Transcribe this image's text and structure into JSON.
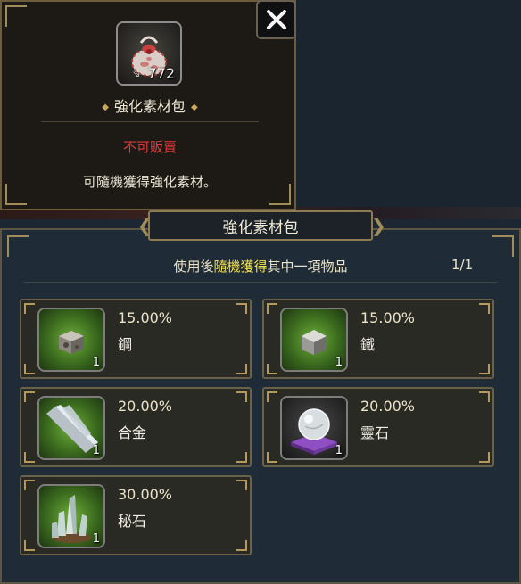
{
  "tooltip": {
    "item_count": "772",
    "item_name": "強化素材包",
    "no_sell": "不可販賣",
    "description": "可隨機獲得強化素材。"
  },
  "package": {
    "title": "強化素材包",
    "hint_prefix": "使用後",
    "hint_highlight": "隨機獲得",
    "hint_suffix": "其中一項物品",
    "page": "1/1",
    "items": [
      {
        "rate": "15.00%",
        "name": "鋼",
        "qty": "1",
        "icon": "steel-ingot-icon"
      },
      {
        "rate": "15.00%",
        "name": "鐵",
        "qty": "1",
        "icon": "iron-ore-icon"
      },
      {
        "rate": "20.00%",
        "name": "合金",
        "qty": "1",
        "icon": "alloy-plate-icon"
      },
      {
        "rate": "20.00%",
        "name": "靈石",
        "qty": "1",
        "icon": "spirit-stone-orb-icon"
      },
      {
        "rate": "30.00%",
        "name": "秘石",
        "qty": "1",
        "icon": "mystic-crystal-icon"
      }
    ]
  },
  "colors": {
    "no_sell": "#e0393b",
    "highlight": "#f3e24f",
    "frame_gold": "#a18c5a",
    "panel_bg": "#1f2c37"
  }
}
